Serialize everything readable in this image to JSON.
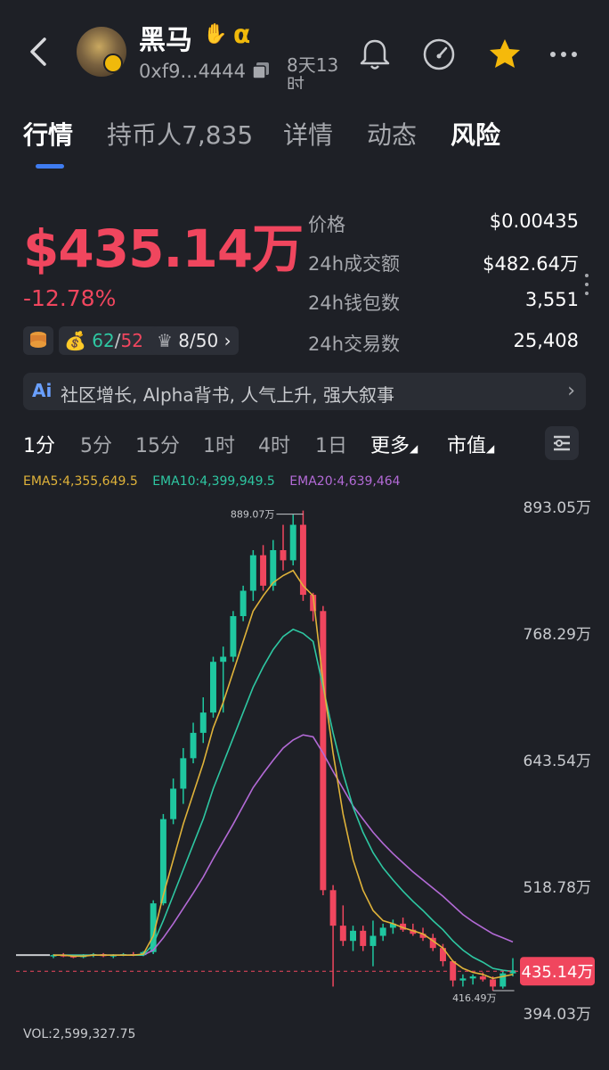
{
  "header": {
    "token_name": "黑马",
    "address": "0xf9...4444",
    "age": "8天13时",
    "alpha_symbol": "α",
    "icons": [
      "back-chevron-icon",
      "hand-icon",
      "copy-icon",
      "bell-icon",
      "gauge-icon",
      "star-icon",
      "more-icon"
    ]
  },
  "tabs": [
    {
      "label": "行情",
      "active": true
    },
    {
      "label": "持币人7,835",
      "active": false
    },
    {
      "label": "详情",
      "active": false
    },
    {
      "label": "动态",
      "active": false
    },
    {
      "label": "风险",
      "active": false
    }
  ],
  "summary": {
    "market_cap": "$435.14万",
    "change": "-12.78%",
    "wallet_ratio_a": "62",
    "wallet_ratio_b": "52",
    "rank": "8/50"
  },
  "stats": [
    {
      "label": "价格",
      "value": "$0.00435"
    },
    {
      "label": "24h成交额",
      "value": "$482.64万"
    },
    {
      "label": "24h钱包数",
      "value": "3,551"
    },
    {
      "label": "24h交易数",
      "value": "25,408"
    }
  ],
  "tags_bar": {
    "ai_label": "Ai",
    "text": "社区增长, Alpha背书, 人气上升, 强大叙事"
  },
  "intervals": [
    {
      "label": "1分",
      "active": true
    },
    {
      "label": "5分",
      "active": false
    },
    {
      "label": "15分",
      "active": false
    },
    {
      "label": "1时",
      "active": false
    },
    {
      "label": "4时",
      "active": false
    },
    {
      "label": "1日",
      "active": false
    },
    {
      "label": "更多",
      "active": false
    },
    {
      "label": "市值",
      "active": false
    }
  ],
  "ema": {
    "ema5": "EMA5:4,355,649.5",
    "ema10": "EMA10:4,399,949.5",
    "ema20": "EMA20:4,639,464"
  },
  "colors": {
    "up": "#1fc7a0",
    "down": "#f0465e",
    "ema5": "#e0b33a",
    "ema10": "#2ec7a2",
    "ema20": "#b36ad6",
    "accent": "#3f7cf0"
  },
  "chart_data": {
    "type": "candlestick",
    "y_ticks": [
      "893.05万",
      "768.29万",
      "643.54万",
      "518.78万",
      "394.03万"
    ],
    "y_tick_values": [
      893.05,
      768.29,
      643.54,
      518.78,
      394.03
    ],
    "ylim": [
      394.03,
      893.05
    ],
    "current_value": 435.14,
    "current_label": "435.14万",
    "high_label": "889.07万",
    "high_value": 889.07,
    "low_label": "416.49万",
    "low_value": 416.49,
    "candles": [
      {
        "o": 450,
        "h": 452,
        "l": 448,
        "c": 451
      },
      {
        "o": 451,
        "h": 453,
        "l": 449,
        "c": 450
      },
      {
        "o": 450,
        "h": 451,
        "l": 448,
        "c": 449
      },
      {
        "o": 449,
        "h": 452,
        "l": 448,
        "c": 451
      },
      {
        "o": 451,
        "h": 453,
        "l": 449,
        "c": 452
      },
      {
        "o": 452,
        "h": 453,
        "l": 449,
        "c": 450
      },
      {
        "o": 450,
        "h": 452,
        "l": 448,
        "c": 451
      },
      {
        "o": 451,
        "h": 453,
        "l": 450,
        "c": 452
      },
      {
        "o": 452,
        "h": 454,
        "l": 450,
        "c": 451
      },
      {
        "o": 451,
        "h": 455,
        "l": 450,
        "c": 454
      },
      {
        "o": 454,
        "h": 505,
        "l": 452,
        "c": 502
      },
      {
        "o": 502,
        "h": 590,
        "l": 500,
        "c": 585
      },
      {
        "o": 585,
        "h": 625,
        "l": 580,
        "c": 615
      },
      {
        "o": 615,
        "h": 655,
        "l": 600,
        "c": 645
      },
      {
        "o": 645,
        "h": 680,
        "l": 640,
        "c": 670
      },
      {
        "o": 670,
        "h": 705,
        "l": 660,
        "c": 690
      },
      {
        "o": 690,
        "h": 745,
        "l": 685,
        "c": 740
      },
      {
        "o": 740,
        "h": 755,
        "l": 690,
        "c": 745
      },
      {
        "o": 745,
        "h": 790,
        "l": 740,
        "c": 785
      },
      {
        "o": 785,
        "h": 815,
        "l": 780,
        "c": 810
      },
      {
        "o": 810,
        "h": 850,
        "l": 800,
        "c": 845
      },
      {
        "o": 845,
        "h": 855,
        "l": 810,
        "c": 815
      },
      {
        "o": 815,
        "h": 860,
        "l": 810,
        "c": 850
      },
      {
        "o": 850,
        "h": 875,
        "l": 830,
        "c": 840
      },
      {
        "o": 840,
        "h": 885,
        "l": 835,
        "c": 875
      },
      {
        "o": 875,
        "h": 889,
        "l": 800,
        "c": 806
      },
      {
        "o": 806,
        "h": 808,
        "l": 780,
        "c": 790
      },
      {
        "o": 790,
        "h": 795,
        "l": 510,
        "c": 515
      },
      {
        "o": 515,
        "h": 520,
        "l": 420,
        "c": 480
      },
      {
        "o": 480,
        "h": 500,
        "l": 460,
        "c": 465
      },
      {
        "o": 465,
        "h": 480,
        "l": 455,
        "c": 475
      },
      {
        "o": 475,
        "h": 480,
        "l": 455,
        "c": 460
      },
      {
        "o": 460,
        "h": 485,
        "l": 440,
        "c": 470
      },
      {
        "o": 470,
        "h": 482,
        "l": 465,
        "c": 478
      },
      {
        "o": 478,
        "h": 486,
        "l": 472,
        "c": 482
      },
      {
        "o": 482,
        "h": 488,
        "l": 474,
        "c": 476
      },
      {
        "o": 476,
        "h": 482,
        "l": 470,
        "c": 472
      },
      {
        "o": 472,
        "h": 478,
        "l": 465,
        "c": 468
      },
      {
        "o": 468,
        "h": 472,
        "l": 455,
        "c": 458
      },
      {
        "o": 458,
        "h": 462,
        "l": 440,
        "c": 445
      },
      {
        "o": 445,
        "h": 446,
        "l": 420,
        "c": 426
      },
      {
        "o": 426,
        "h": 432,
        "l": 420,
        "c": 428
      },
      {
        "o": 428,
        "h": 432,
        "l": 422,
        "c": 430
      },
      {
        "o": 430,
        "h": 434,
        "l": 425,
        "c": 427
      },
      {
        "o": 427,
        "h": 430,
        "l": 416,
        "c": 420
      },
      {
        "o": 420,
        "h": 435,
        "l": 418,
        "c": 433
      },
      {
        "o": 433,
        "h": 448,
        "l": 430,
        "c": 436
      }
    ],
    "ema5": [
      451,
      451,
      450,
      450,
      451,
      451,
      451,
      451,
      451,
      452,
      470,
      510,
      545,
      580,
      610,
      640,
      675,
      700,
      730,
      760,
      790,
      805,
      818,
      825,
      830,
      815,
      805,
      720,
      650,
      590,
      545,
      515,
      495,
      485,
      482,
      478,
      475,
      472,
      465,
      458,
      445,
      438,
      434,
      432,
      428,
      430,
      432
    ],
    "ema10": [
      451,
      451,
      451,
      451,
      451,
      451,
      451,
      451,
      451,
      451,
      462,
      485,
      510,
      535,
      560,
      585,
      615,
      640,
      665,
      690,
      715,
      735,
      752,
      765,
      772,
      768,
      760,
      715,
      670,
      630,
      597,
      572,
      552,
      537,
      525,
      514,
      504,
      495,
      485,
      476,
      465,
      456,
      449,
      444,
      438,
      436,
      435
    ],
    "ema20": [
      451,
      451,
      451,
      451,
      451,
      451,
      451,
      451,
      451,
      451,
      456,
      468,
      482,
      497,
      512,
      528,
      546,
      563,
      580,
      598,
      616,
      630,
      643,
      655,
      663,
      668,
      666,
      650,
      632,
      615,
      598,
      585,
      572,
      561,
      551,
      542,
      533,
      525,
      517,
      509,
      500,
      491,
      484,
      478,
      472,
      468,
      464
    ]
  },
  "volume_label": "VOL:2,599,327.75"
}
